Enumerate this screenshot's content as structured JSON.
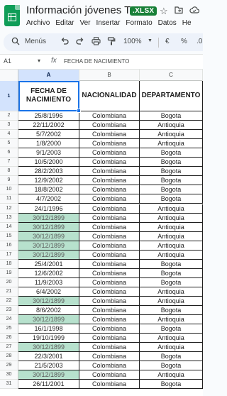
{
  "app": {
    "title": "Información jóvenes TMC",
    "badge": ".XLSX",
    "icons": [
      "star-icon",
      "move-to-folder-icon",
      "cloud-status-icon"
    ],
    "menu": [
      "Archivo",
      "Editar",
      "Ver",
      "Insertar",
      "Formato",
      "Datos",
      "He"
    ]
  },
  "toolbar": {
    "search_label": "Menús",
    "zoom": "100%",
    "currency": "€",
    "percent": "%",
    "decimal_dec": ".0"
  },
  "formula": {
    "cell_ref": "A1",
    "fx": "fx",
    "content": "FECHA DE NACIMIENTO"
  },
  "columns": [
    "A",
    "B",
    "C"
  ],
  "header_row": {
    "number": "1",
    "cells": [
      "FECHA DE\nNACIMIENTO",
      "NACIONALIDAD",
      "DEPARTAMENTO"
    ]
  },
  "rows": [
    {
      "n": "2",
      "date": "25/8/1996",
      "nat": "Colombiana",
      "dep": "Bogota",
      "hl": false
    },
    {
      "n": "3",
      "date": "22/11/2002",
      "nat": "Colombiana",
      "dep": "Antioquia",
      "hl": false
    },
    {
      "n": "4",
      "date": "5/7/2002",
      "nat": "Colombiana",
      "dep": "Antioquia",
      "hl": false
    },
    {
      "n": "5",
      "date": "1/8/2000",
      "nat": "Colombiana",
      "dep": "Antioquia",
      "hl": false
    },
    {
      "n": "6",
      "date": "9/1/2003",
      "nat": "Colombiana",
      "dep": "Bogota",
      "hl": false
    },
    {
      "n": "7",
      "date": "10/5/2000",
      "nat": "Colombiana",
      "dep": "Bogota",
      "hl": false
    },
    {
      "n": "8",
      "date": "28/2/2003",
      "nat": "Colombiana",
      "dep": "Bogota",
      "hl": false
    },
    {
      "n": "9",
      "date": "12/9/2002",
      "nat": "Colombiana",
      "dep": "Bogota",
      "hl": false
    },
    {
      "n": "10",
      "date": "18/8/2002",
      "nat": "Colombiana",
      "dep": "Bogota",
      "hl": false
    },
    {
      "n": "11",
      "date": "4/7/2002",
      "nat": "Colombiana",
      "dep": "Bogota",
      "hl": false
    },
    {
      "n": "12",
      "date": "24/1/1996",
      "nat": "Colombiana",
      "dep": "Antioquia",
      "hl": false
    },
    {
      "n": "13",
      "date": "30/12/1899",
      "nat": "Colombiana",
      "dep": "Antioquia",
      "hl": true
    },
    {
      "n": "14",
      "date": "30/12/1899",
      "nat": "Colombiana",
      "dep": "Antioquia",
      "hl": true
    },
    {
      "n": "15",
      "date": "30/12/1899",
      "nat": "Colombiana",
      "dep": "Antioquia",
      "hl": true
    },
    {
      "n": "16",
      "date": "30/12/1899",
      "nat": "Colombiana",
      "dep": "Antioquia",
      "hl": true
    },
    {
      "n": "17",
      "date": "30/12/1899",
      "nat": "Colombiana",
      "dep": "Antioquia",
      "hl": true
    },
    {
      "n": "18",
      "date": "25/4/2001",
      "nat": "Colombiana",
      "dep": "Bogota",
      "hl": false
    },
    {
      "n": "19",
      "date": "12/6/2002",
      "nat": "Colombiana",
      "dep": "Bogota",
      "hl": false
    },
    {
      "n": "20",
      "date": "11/9/2003",
      "nat": "Colombiana",
      "dep": "Bogota",
      "hl": false
    },
    {
      "n": "21",
      "date": "6/4/2002",
      "nat": "Colombiana",
      "dep": "Antioquia",
      "hl": false
    },
    {
      "n": "22",
      "date": "30/12/1899",
      "nat": "Colombiana",
      "dep": "Antioquia",
      "hl": true
    },
    {
      "n": "23",
      "date": "8/6/2002",
      "nat": "Colombiana",
      "dep": "Bogota",
      "hl": false
    },
    {
      "n": "24",
      "date": "30/12/1899",
      "nat": "Colombiana",
      "dep": "Antioquia",
      "hl": true
    },
    {
      "n": "25",
      "date": "16/1/1998",
      "nat": "Colombiana",
      "dep": "Bogota",
      "hl": false
    },
    {
      "n": "26",
      "date": "19/10/1999",
      "nat": "Colombiana",
      "dep": "Antioquia",
      "hl": false
    },
    {
      "n": "27",
      "date": "30/12/1899",
      "nat": "Colombiana",
      "dep": "Antioquia",
      "hl": true
    },
    {
      "n": "28",
      "date": "22/3/2001",
      "nat": "Colombiana",
      "dep": "Bogota",
      "hl": false
    },
    {
      "n": "29",
      "date": "21/5/2003",
      "nat": "Colombiana",
      "dep": "Bogota",
      "hl": false
    },
    {
      "n": "30",
      "date": "30/12/1899",
      "nat": "Colombiana",
      "dep": "Antioquia",
      "hl": true
    },
    {
      "n": "31",
      "date": "26/11/2001",
      "nat": "Colombiana",
      "dep": "Bogota",
      "hl": false
    }
  ],
  "colors": {
    "highlight": "#b7e1cd",
    "selection": "#1a73e8",
    "sheets_green": "#0f9d58"
  }
}
